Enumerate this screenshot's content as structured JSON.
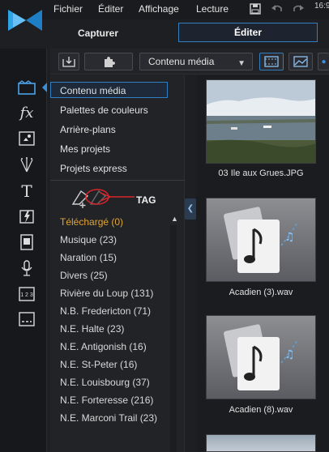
{
  "menu": {
    "items": [
      "Fichier",
      "Éditer",
      "Affichage",
      "Lecture"
    ],
    "timecode": "16:9"
  },
  "modes": {
    "capture_label": "Capturer",
    "edit_label": "Éditer"
  },
  "library": {
    "combo_value": "Contenu média"
  },
  "categories": {
    "items": [
      "Contenu média",
      "Palettes de couleurs",
      "Arrière-plans",
      "Mes projets",
      "Projets express"
    ],
    "selected": "Contenu média"
  },
  "tags": {
    "annotation": "TAG",
    "items": [
      "Téléchargé  (0)",
      "Musique  (23)",
      "Naration  (15)",
      "Divers  (25)",
      "Rivière du Loup  (131)",
      "N.B. Fredericton  (71)",
      "N.E. Halte  (23)",
      "N.E. Antigonish  (16)",
      "N.E. St-Peter  (16)",
      "N.E. Louisbourg  (37)",
      "N.E. Forteresse  (216)",
      "N.E. Marconi Trail  (23)"
    ],
    "selected_index": 0
  },
  "thumbnails": [
    {
      "label": "03 Ile aux Grues.JPG",
      "kind": "photo"
    },
    {
      "label": "Acadien (3).wav",
      "kind": "audio"
    },
    {
      "label": "Acadien (8).wav",
      "kind": "audio"
    }
  ],
  "colors": {
    "accent": "#2f7fc1",
    "selected_tag": "#e0a43a",
    "annotation_red": "#d8242a"
  }
}
